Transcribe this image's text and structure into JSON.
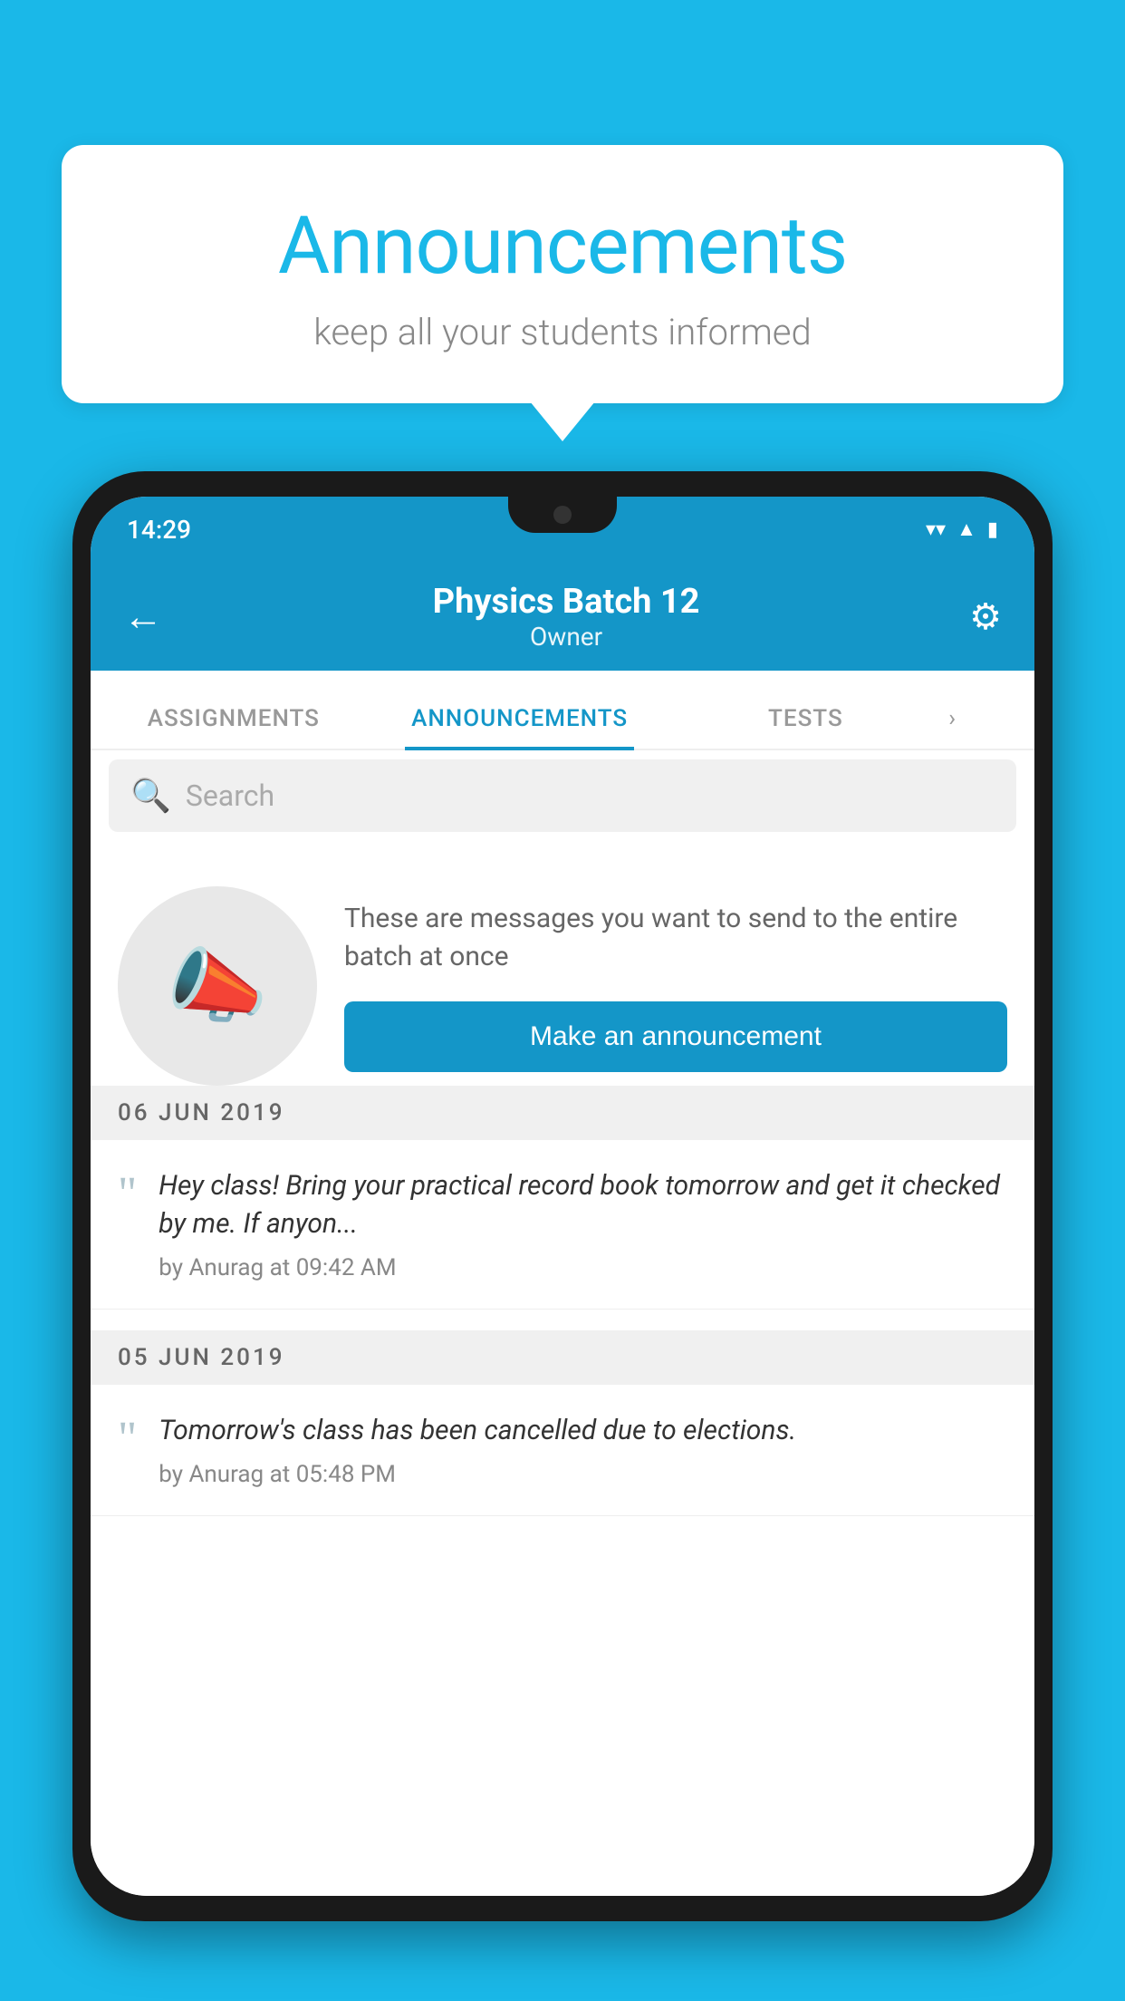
{
  "page": {
    "background_color": "#1ab8e8"
  },
  "speech_bubble": {
    "title": "Announcements",
    "subtitle": "keep all your students informed"
  },
  "phone": {
    "status_bar": {
      "time": "14:29",
      "wifi": "▾",
      "signal": "▾",
      "battery": "▾"
    },
    "header": {
      "title": "Physics Batch 12",
      "subtitle": "Owner",
      "back_label": "←",
      "settings_label": "⚙"
    },
    "tabs": [
      {
        "label": "ASSIGNMENTS",
        "active": false
      },
      {
        "label": "ANNOUNCEMENTS",
        "active": true
      },
      {
        "label": "TESTS",
        "active": false
      }
    ],
    "search": {
      "placeholder": "Search"
    },
    "empty_state": {
      "description": "These are messages you want to send to the entire batch at once",
      "button_label": "Make an announcement"
    },
    "date_dividers": [
      {
        "date": "06  JUN  2019"
      },
      {
        "date": "05  JUN  2019"
      }
    ],
    "announcements": [
      {
        "message": "Hey class! Bring your practical record book tomorrow and get it checked by me. If anyon...",
        "meta": "by Anurag at 09:42 AM"
      },
      {
        "message": "Tomorrow's class has been cancelled due to elections.",
        "meta": "by Anurag at 05:48 PM"
      }
    ]
  }
}
